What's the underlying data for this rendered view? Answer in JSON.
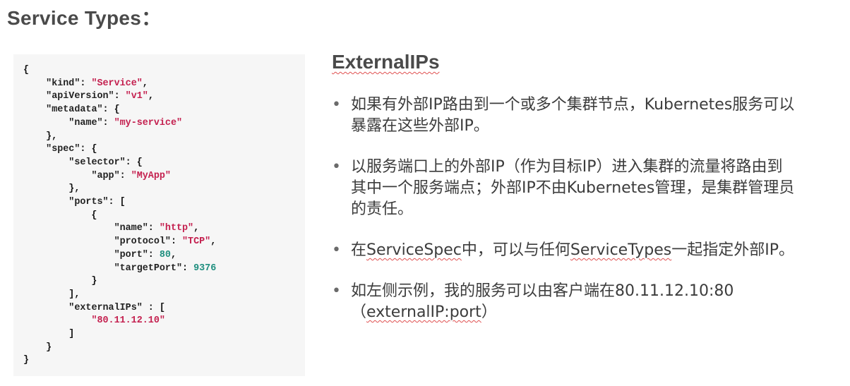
{
  "title": "Service Types：",
  "code_lines": [
    [
      {
        "t": "p",
        "v": "{"
      }
    ],
    [
      {
        "t": "p",
        "v": "    "
      },
      {
        "t": "k",
        "v": "\"kind\""
      },
      {
        "t": "p",
        "v": ": "
      },
      {
        "t": "s",
        "v": "\"Service\""
      },
      {
        "t": "p",
        "v": ","
      }
    ],
    [
      {
        "t": "p",
        "v": "    "
      },
      {
        "t": "k",
        "v": "\"apiVersion\""
      },
      {
        "t": "p",
        "v": ": "
      },
      {
        "t": "s",
        "v": "\"v1\""
      },
      {
        "t": "p",
        "v": ","
      }
    ],
    [
      {
        "t": "p",
        "v": "    "
      },
      {
        "t": "k",
        "v": "\"metadata\""
      },
      {
        "t": "p",
        "v": ": {"
      }
    ],
    [
      {
        "t": "p",
        "v": "        "
      },
      {
        "t": "k",
        "v": "\"name\""
      },
      {
        "t": "p",
        "v": ": "
      },
      {
        "t": "s",
        "v": "\"my-service\""
      }
    ],
    [
      {
        "t": "p",
        "v": "    },"
      }
    ],
    [
      {
        "t": "p",
        "v": "    "
      },
      {
        "t": "k",
        "v": "\"spec\""
      },
      {
        "t": "p",
        "v": ": {"
      }
    ],
    [
      {
        "t": "p",
        "v": "        "
      },
      {
        "t": "k",
        "v": "\"selector\""
      },
      {
        "t": "p",
        "v": ": {"
      }
    ],
    [
      {
        "t": "p",
        "v": "            "
      },
      {
        "t": "k",
        "v": "\"app\""
      },
      {
        "t": "p",
        "v": ": "
      },
      {
        "t": "s",
        "v": "\"MyApp\""
      }
    ],
    [
      {
        "t": "p",
        "v": "        },"
      }
    ],
    [
      {
        "t": "p",
        "v": "        "
      },
      {
        "t": "k",
        "v": "\"ports\""
      },
      {
        "t": "p",
        "v": ": ["
      }
    ],
    [
      {
        "t": "p",
        "v": "            {"
      }
    ],
    [
      {
        "t": "p",
        "v": "                "
      },
      {
        "t": "k",
        "v": "\"name\""
      },
      {
        "t": "p",
        "v": ": "
      },
      {
        "t": "s",
        "v": "\"http\""
      },
      {
        "t": "p",
        "v": ","
      }
    ],
    [
      {
        "t": "p",
        "v": "                "
      },
      {
        "t": "k",
        "v": "\"protocol\""
      },
      {
        "t": "p",
        "v": ": "
      },
      {
        "t": "s",
        "v": "\"TCP\""
      },
      {
        "t": "p",
        "v": ","
      }
    ],
    [
      {
        "t": "p",
        "v": "                "
      },
      {
        "t": "k",
        "v": "\"port\""
      },
      {
        "t": "p",
        "v": ": "
      },
      {
        "t": "n",
        "v": "80"
      },
      {
        "t": "p",
        "v": ","
      }
    ],
    [
      {
        "t": "p",
        "v": "                "
      },
      {
        "t": "k",
        "v": "\"targetPort\""
      },
      {
        "t": "p",
        "v": ": "
      },
      {
        "t": "n",
        "v": "9376"
      }
    ],
    [
      {
        "t": "p",
        "v": "            }"
      }
    ],
    [
      {
        "t": "p",
        "v": "        ],"
      }
    ],
    [
      {
        "t": "p",
        "v": "        "
      },
      {
        "t": "k",
        "v": "\"externalIPs\""
      },
      {
        "t": "p",
        "v": " : ["
      }
    ],
    [
      {
        "t": "p",
        "v": "            "
      },
      {
        "t": "s",
        "v": "\"80.11.12.10\""
      }
    ],
    [
      {
        "t": "p",
        "v": "        ]"
      }
    ],
    [
      {
        "t": "p",
        "v": "    }"
      }
    ],
    [
      {
        "t": "p",
        "v": "}"
      }
    ]
  ],
  "heading": "ExternalIPs",
  "bullets": [
    [
      "如果有外部IP路由到一个或多个集群节点，Kubernetes服务可以",
      "暴露在这些外部IP。"
    ],
    [
      "以服务端口上的外部IP（作为目标IP）进入集群的流量将路由到",
      "其中一个服务端点；外部IP不由Kubernetes管理，是集群管理员",
      "的责任。"
    ],
    [
      "在ServiceSpec中，可以与任何ServiceTypes一起指定外部IP。"
    ],
    [
      "如左侧示例，我的服务可以由客户端在80.11.12.10:80",
      "（externalIP:port）"
    ]
  ],
  "bullet_symbol": "•"
}
